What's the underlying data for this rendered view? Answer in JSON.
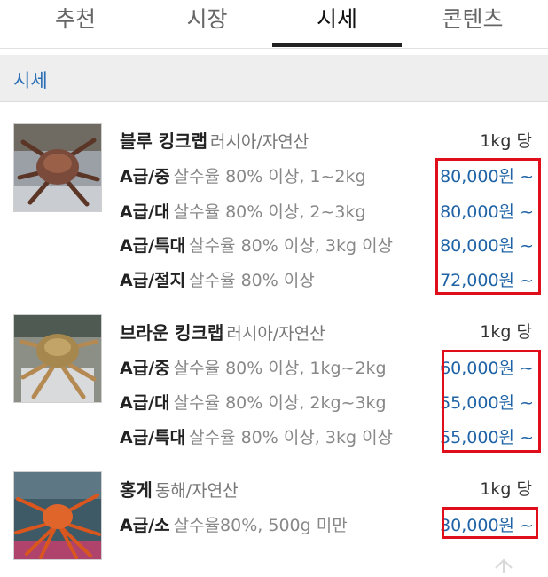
{
  "tabs": [
    {
      "label": "추천"
    },
    {
      "label": "시장"
    },
    {
      "label": "시세",
      "active": true
    },
    {
      "label": "콘텐츠"
    }
  ],
  "section": {
    "title": "시세"
  },
  "products": [
    {
      "name": "블루 킹크랩",
      "origin": "러시아/자연산",
      "unit": "1kg 당",
      "rows": [
        {
          "grade": "A급/중",
          "spec": "살수율 80% 이상, 1~2kg",
          "price": "80,000원 ~"
        },
        {
          "grade": "A급/대",
          "spec": "살수율 80% 이상, 2~3kg",
          "price": "80,000원 ~"
        },
        {
          "grade": "A급/특대",
          "spec": "살수율 80% 이상, 3kg 이상",
          "price": "80,000원 ~"
        },
        {
          "grade": "A급/절지",
          "spec": "살수율 80% 이상",
          "price": "72,000원 ~"
        }
      ]
    },
    {
      "name": "브라운 킹크랩",
      "origin": "러시아/자연산",
      "unit": "1kg 당",
      "rows": [
        {
          "grade": "A급/중",
          "spec": "살수율 80% 이상, 1kg~2kg",
          "price": "60,000원 ~"
        },
        {
          "grade": "A급/대",
          "spec": "살수율 80% 이상, 2kg~3kg",
          "price": "55,000원 ~"
        },
        {
          "grade": "A급/특대",
          "spec": "살수율 80% 이상, 3kg 이상",
          "price": "55,000원 ~"
        }
      ]
    },
    {
      "name": "홍게",
      "origin": "동해/자연산",
      "unit": "1kg 당",
      "rows": [
        {
          "grade": "A급/소",
          "spec": "살수율80%, 500g 미만",
          "price": "30,000원 ~"
        }
      ]
    }
  ],
  "colors": {
    "accent": "#2a6fb5",
    "price": "#1f63a6",
    "highlight_box": "#e00d1a"
  },
  "icons": {
    "scroll_top": "arrow-up-icon"
  }
}
